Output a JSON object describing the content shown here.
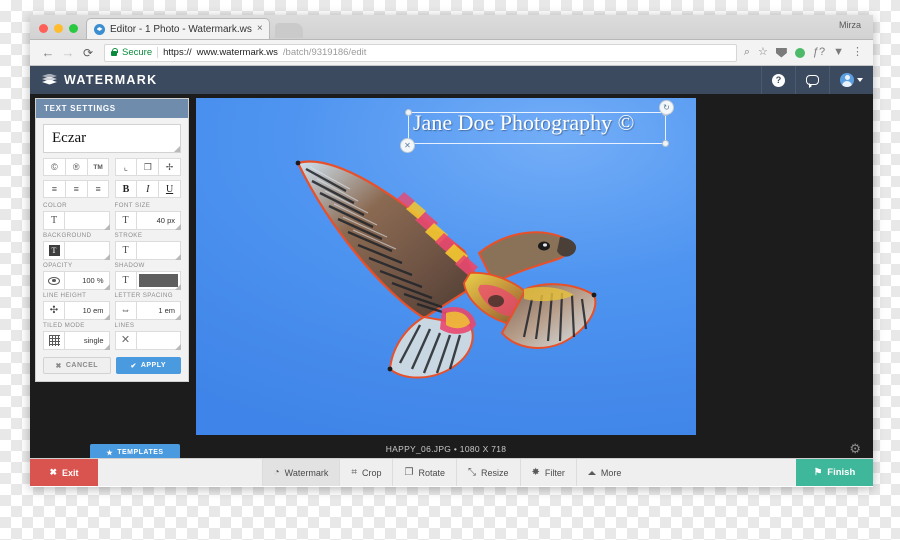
{
  "browser": {
    "tab_title": "Editor - 1 Photo - Watermark.ws",
    "tab_close": "×",
    "profile_name": "Mirza",
    "nav": {
      "back": "←",
      "forward": "→",
      "reload": "⟳"
    },
    "url": {
      "secure_label": "Secure",
      "scheme": "https://",
      "host": "www.watermark.ws",
      "path": "/batch/9319186/edit"
    },
    "toolbar_icons": [
      {
        "name": "search-icon",
        "glyph": "⌕"
      },
      {
        "name": "bookmark-star-icon",
        "glyph": "☆"
      },
      {
        "name": "extension-shield-icon",
        "glyph": ""
      },
      {
        "name": "status-green-dot-icon",
        "glyph": ""
      },
      {
        "name": "font-extension-icon",
        "glyph": "ƒ?"
      },
      {
        "name": "filter-extension-icon",
        "glyph": "▼"
      },
      {
        "name": "chrome-menu-icon",
        "glyph": "⋮"
      }
    ]
  },
  "app": {
    "brand": "WATERMARK",
    "header_buttons": [
      {
        "name": "help-button",
        "label": "?"
      },
      {
        "name": "chat-button",
        "label": ""
      },
      {
        "name": "account-button",
        "label": ""
      }
    ]
  },
  "panel": {
    "title": "TEXT SETTINGS",
    "font": {
      "value": "Eczar"
    },
    "symbol_buttons": [
      {
        "name": "copyright-symbol-button",
        "glyph": "©"
      },
      {
        "name": "registered-symbol-button",
        "glyph": "®"
      },
      {
        "name": "trademark-symbol-button",
        "glyph": "TM"
      }
    ],
    "transform_buttons": [
      {
        "name": "rotate-corner-button",
        "glyph": "⌞"
      },
      {
        "name": "duplicate-button",
        "glyph": "❐"
      },
      {
        "name": "move-button",
        "glyph": "✢"
      }
    ],
    "align_buttons": [
      {
        "name": "align-left-button",
        "glyph": "≡"
      },
      {
        "name": "align-center-button",
        "glyph": "≡"
      },
      {
        "name": "align-right-button",
        "glyph": "≡"
      }
    ],
    "style_buttons": [
      {
        "name": "bold-button",
        "glyph": "B"
      },
      {
        "name": "italic-button",
        "glyph": "I"
      },
      {
        "name": "underline-button",
        "glyph": "U"
      }
    ],
    "fields": [
      {
        "name": "color-field",
        "label": "COLOR",
        "icon": "T",
        "value": ""
      },
      {
        "name": "font-size-field",
        "label": "FONT SIZE",
        "icon": "T",
        "value": "40 px"
      },
      {
        "name": "background-field",
        "label": "BACKGROUND",
        "icon": "T",
        "value": ""
      },
      {
        "name": "stroke-field",
        "label": "STROKE",
        "icon": "T",
        "value": ""
      },
      {
        "name": "opacity-field",
        "label": "OPACITY",
        "icon": "",
        "value": "100 %"
      },
      {
        "name": "shadow-field",
        "label": "SHADOW",
        "icon": "T",
        "value": ""
      },
      {
        "name": "line-height-field",
        "label": "LINE HEIGHT",
        "icon": "✣",
        "value": "10 em"
      },
      {
        "name": "letter-spacing-field",
        "label": "LETTER SPACING",
        "icon": "⇔",
        "value": "1 em"
      },
      {
        "name": "tiled-mode-field",
        "label": "TILED MODE",
        "icon": "",
        "value": "single"
      },
      {
        "name": "lines-field",
        "label": "LINES",
        "icon": "✕",
        "value": ""
      }
    ],
    "cancel_label": "CANCEL",
    "cancel_glyph": "✖",
    "apply_label": "APPLY",
    "apply_glyph": "✔"
  },
  "canvas": {
    "watermark_text": "Jane Doe Photography ©",
    "rotate_handle_glyph": "↻",
    "delete_handle_glyph": "✕",
    "file_info": "HAPPY_06.JPG • 1080 X 718",
    "templates_label": "TEMPLATES",
    "templates_glyph": "★",
    "gear_glyph": "⚙"
  },
  "toolbar": {
    "exit_label": "Exit",
    "exit_glyph": "✖",
    "tools": [
      {
        "name": "tool-watermark",
        "label": "Watermark",
        "glyph": "◔",
        "active": true
      },
      {
        "name": "tool-crop",
        "label": "Crop",
        "glyph": "⌗",
        "active": false
      },
      {
        "name": "tool-rotate",
        "label": "Rotate",
        "glyph": "❐",
        "active": false
      },
      {
        "name": "tool-resize",
        "label": "Resize",
        "glyph": "⤡",
        "active": false
      },
      {
        "name": "tool-filter",
        "label": "Filter",
        "glyph": "✸",
        "active": false
      },
      {
        "name": "tool-more",
        "label": "More",
        "glyph": "",
        "active": false
      }
    ],
    "finish_label": "Finish",
    "finish_glyph": "⚑"
  },
  "colors": {
    "app_header": "#3b4a5e",
    "panel_header": "#6f8cad",
    "accent_blue": "#4a9ae0",
    "exit_red": "#d9534f",
    "finish_teal": "#3fb79a",
    "sky_blue": "#4a91ef",
    "secure_green": "#0a8a3c"
  }
}
